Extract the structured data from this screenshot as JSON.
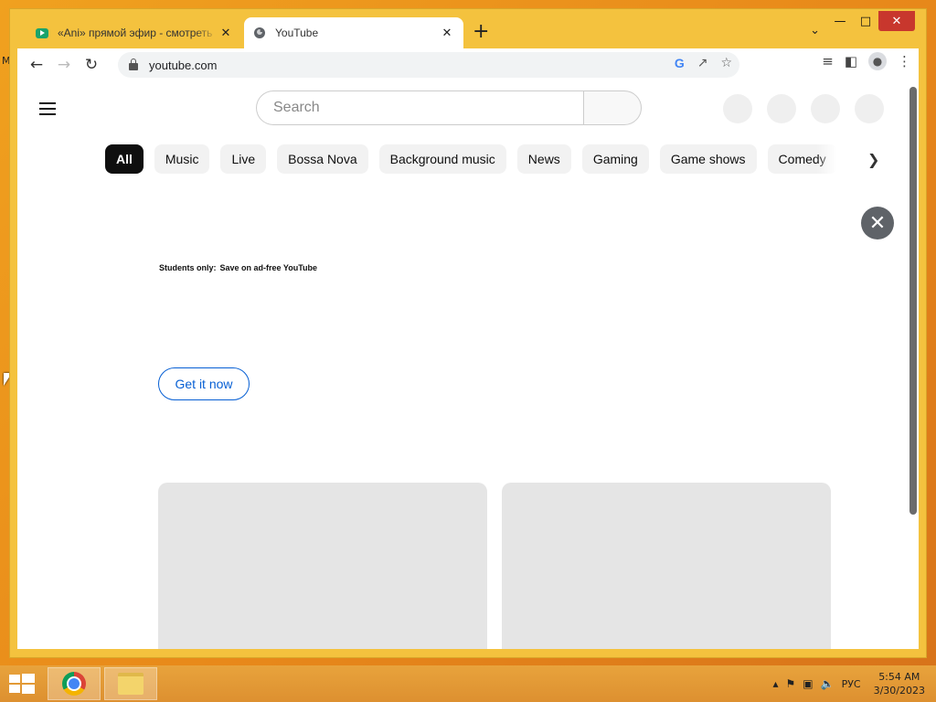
{
  "browser": {
    "tabs": [
      {
        "title": "«Ani» прямой эфир - смотреть",
        "favicon": "tv-icon",
        "active": false
      },
      {
        "title": "YouTube",
        "favicon": "globe-icon",
        "active": true
      }
    ],
    "new_tab": "+",
    "url": "youtube.com"
  },
  "youtube": {
    "search_placeholder": "Search",
    "chips": [
      "All",
      "Music",
      "Live",
      "Bossa Nova",
      "Background music",
      "News",
      "Gaming",
      "Game shows",
      "Comedy"
    ],
    "promo": {
      "label": "Students only:",
      "text": "Save on ad-free YouTube",
      "cta": "Get it now"
    }
  },
  "taskbar": {
    "language": "РУС",
    "time": "5:54 AM",
    "date": "3/30/2023"
  },
  "colors": {
    "window_frame": "#f4c23e",
    "cta_blue": "#065fd4",
    "chip_active": "#0f0f0f"
  }
}
